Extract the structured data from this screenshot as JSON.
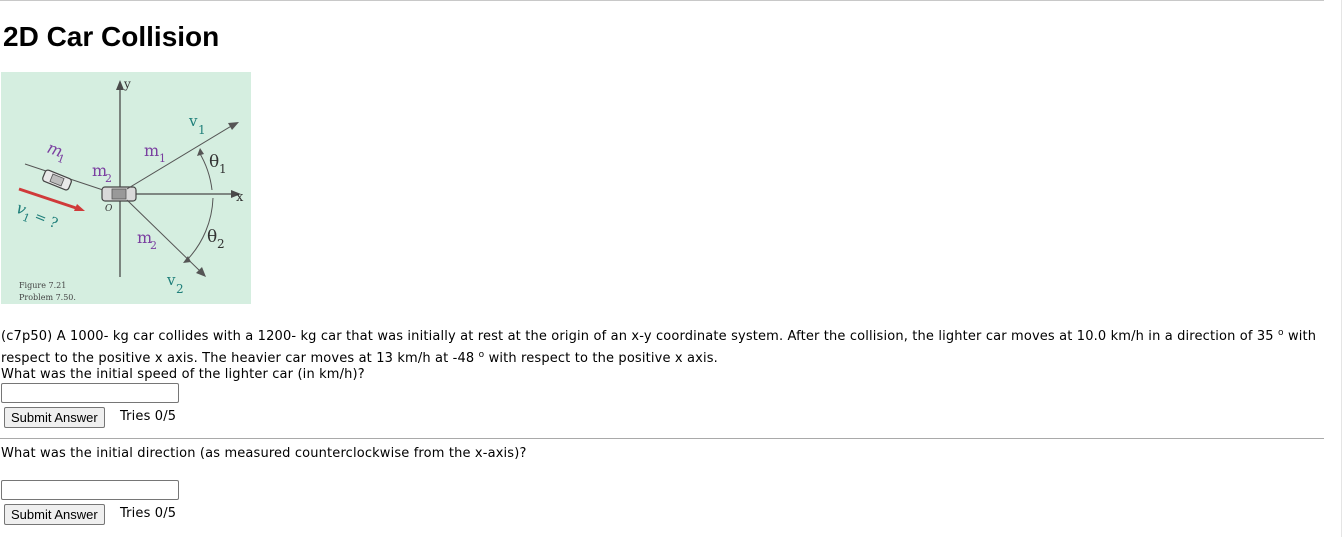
{
  "page": {
    "title": "2D Car Collision"
  },
  "figure": {
    "labels": {
      "axis_y": "y",
      "axis_x": "x",
      "m1_left": "m",
      "m1_left_sub": "1",
      "v1_left": "v",
      "v1_left_sub": "1",
      "v1_unknown": "= ?",
      "m2_center": "m",
      "m2_center_sub": "2",
      "origin": "O",
      "m1_right": "m",
      "m1_right_sub": "1",
      "v1_right": "v",
      "v1_right_sub": "1",
      "theta1": "θ",
      "theta1_sub": "1",
      "theta2": "θ",
      "theta2_sub": "2",
      "m2_lower": "m",
      "m2_lower_sub": "2",
      "v2_lower": "v",
      "v2_lower_sub": "2",
      "caption_line1": "Figure 7.21",
      "caption_line2": "Problem 7.50."
    },
    "colors": {
      "background": "#d5eee0",
      "mass_label": "#7a3fa0",
      "velocity_label": "#1f7f7a",
      "arrow_red": "#d03a3a"
    }
  },
  "problem": {
    "text_a": "(c7p50) A 1000- kg car collides with a 1200- kg car that was initially at rest at the origin of an x-y coordinate system. After the collision, the lighter car moves at 10.0 km/h in a direction of 35 ",
    "sup_a": "o",
    "text_b": " with respect to the positive x axis. The heavier car moves at 13 km/h at -48 ",
    "sup_b": "o",
    "text_c": " with respect to the positive x axis."
  },
  "question1": {
    "text": "What was the initial speed of the lighter car (in km/h)?",
    "input_value": "",
    "submit_label": "Submit Answer",
    "tries": "Tries 0/5"
  },
  "question2": {
    "text": "What was the initial direction (as measured counterclockwise from the x-axis)?",
    "input_value": "",
    "submit_label": "Submit Answer",
    "tries": "Tries 0/5"
  }
}
